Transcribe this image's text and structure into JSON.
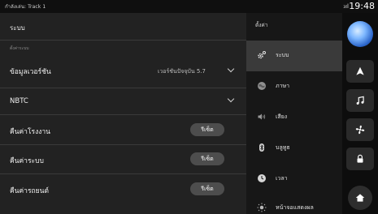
{
  "status": {
    "track": "กำลังเล่น: Track 1",
    "signal": "₃ıl",
    "time": "19:48"
  },
  "settings_panel": {
    "title": "ระบบ",
    "section_label": "ตั้งค่าระบบ",
    "rows": [
      {
        "label": "ข้อมูลเวอร์ชัน",
        "value": "เวอร์ชันปัจจุบัน 5.7"
      },
      {
        "label": "NBTC",
        "value": ""
      },
      {
        "label": "คืนค่าโรงงาน",
        "button": "รีเซ็ต"
      },
      {
        "label": "คืนค่าระบบ",
        "button": "รีเซ็ต"
      },
      {
        "label": "คืนค่ารถยนต์",
        "button": "รีเซ็ต"
      }
    ]
  },
  "menu": {
    "title": "ตั้งค่า",
    "items": [
      {
        "label": "ระบบ",
        "icon": "gear-icon",
        "active": true
      },
      {
        "label": "ภาษา",
        "icon": "globe-icon",
        "active": false
      },
      {
        "label": "เสียง",
        "icon": "speaker-icon",
        "active": false
      },
      {
        "label": "บลูทูธ",
        "icon": "bluetooth-icon",
        "active": false
      },
      {
        "label": "เวลา",
        "icon": "clock-icon",
        "active": false
      },
      {
        "label": "หน้าจอแสดงผล",
        "icon": "brightness-icon",
        "active": false
      }
    ]
  },
  "rail": {
    "buttons": [
      "navigation-icon",
      "music-icon",
      "fan-icon",
      "lock-icon"
    ],
    "home": "home-icon"
  },
  "colors": {
    "panel_bg": "#222222",
    "menu_bg": "#171717",
    "active_item": "#3a3a3a",
    "button_bg": "#4d4d4d"
  }
}
